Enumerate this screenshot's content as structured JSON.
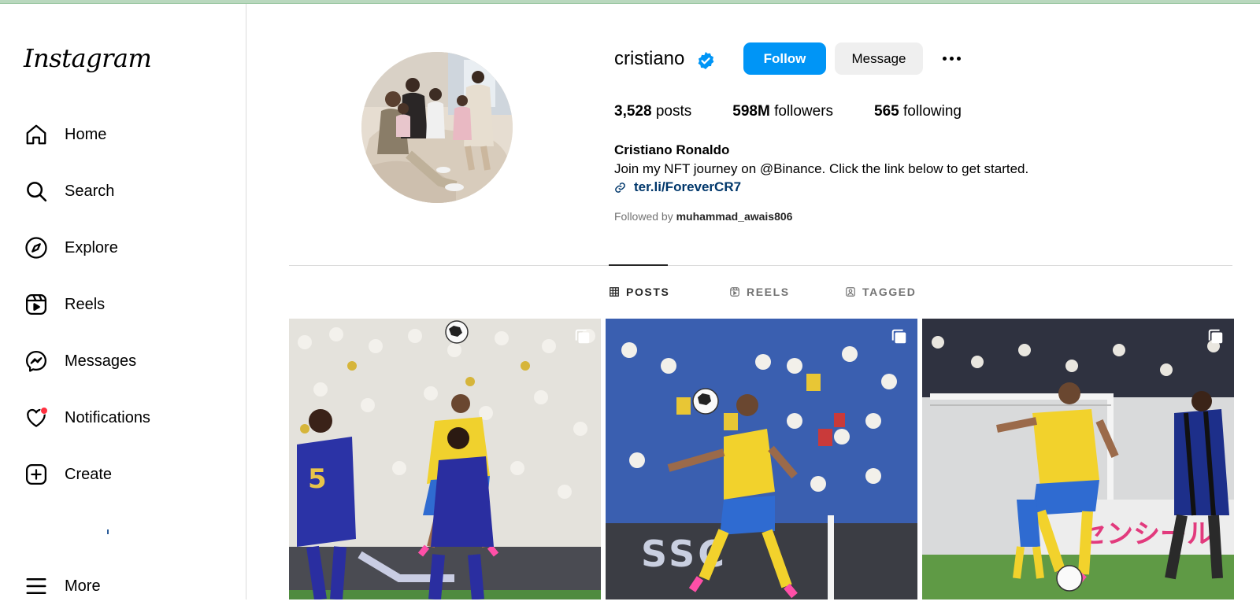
{
  "brand": {
    "logo_text": "Instagram"
  },
  "nav": {
    "home": "Home",
    "search": "Search",
    "explore": "Explore",
    "reels": "Reels",
    "messages": "Messages",
    "notifications": "Notifications",
    "create": "Create",
    "more": "More"
  },
  "profile": {
    "username": "cristiano",
    "follow_label": "Follow",
    "message_label": "Message",
    "posts_count": "3,528",
    "posts_label": "posts",
    "followers_count": "598M",
    "followers_label": "followers",
    "following_count": "565",
    "following_label": "following",
    "full_name": "Cristiano Ronaldo",
    "bio": "Join my NFT journey on @Binance. Click the link below to get started.",
    "link": "ter.li/ForeverCR7",
    "followed_by_prefix": "Followed by",
    "followed_by_user": "muhammad_awais806"
  },
  "tabs": {
    "posts": "POSTS",
    "reels": "REELS",
    "tagged": "TAGGED"
  },
  "colors": {
    "follow_button": "#0095f6",
    "verified": "#0095f6",
    "notification_dot": "#ff3040",
    "link": "#00376b"
  },
  "icons": {
    "verified": "verified-badge-icon",
    "multi_post": "carousel-icon",
    "link": "link-icon"
  }
}
